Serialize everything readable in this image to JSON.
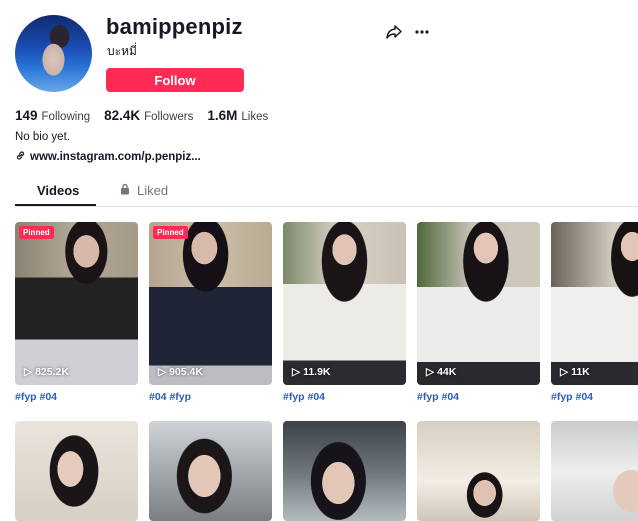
{
  "profile": {
    "username": "bamippenpiz",
    "nickname": "บะหมี่",
    "follow_label": "Follow",
    "bio": "No bio yet.",
    "link": "www.instagram.com/p.penpiz..."
  },
  "stats": [
    {
      "value": "149",
      "label": "Following"
    },
    {
      "value": "82.4K",
      "label": "Followers"
    },
    {
      "value": "1.6M",
      "label": "Likes"
    }
  ],
  "tabs": {
    "videos": "Videos",
    "liked": "Liked"
  },
  "videos_row1": [
    {
      "pinned": "Pinned",
      "views": "825.2K",
      "caption": "#fyp #04"
    },
    {
      "pinned": "Pinned",
      "views": "905.4K",
      "caption": "#04 #fyp"
    },
    {
      "pinned": "",
      "views": "11.9K",
      "caption": "#fyp #04"
    },
    {
      "pinned": "",
      "views": "44K",
      "caption": "#fyp #04"
    },
    {
      "pinned": "",
      "views": "11K",
      "caption": "#fyp #04"
    }
  ],
  "colors": {
    "accent": "#fe2c55",
    "text": "#161823",
    "link_blue": "#2b5db9"
  },
  "icons": [
    "share-icon",
    "more-icon",
    "link-icon",
    "lock-icon",
    "play-icon"
  ]
}
